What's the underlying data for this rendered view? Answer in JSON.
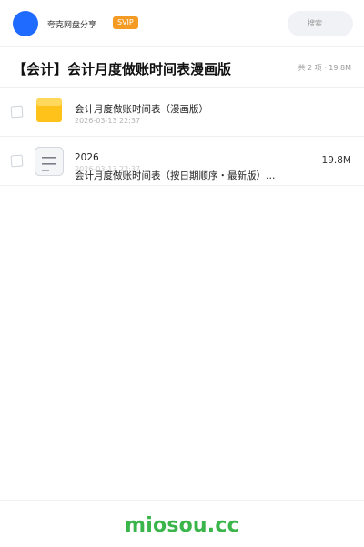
{
  "header": {
    "brand": "夸克网盘分享",
    "svip": "SVIP",
    "search_placeholder": "搜索"
  },
  "page": {
    "title": "【会计】会计月度做账时间表漫画版",
    "summary": "共 2 项 · 19.8M"
  },
  "files": [
    {
      "type": "folder",
      "name": "会计月度做账时间表（漫画版）",
      "date": "2026-03-13 22:37",
      "size": ""
    },
    {
      "type": "document",
      "year": "2026",
      "name": "会计月度做账时间表（按日期顺序・最新版）…",
      "date": "2026-03-13 22:37",
      "size": "19.8M"
    }
  ],
  "footer": {
    "watermark": "miosou.cc"
  },
  "colors": {
    "accent": "#1f6bff",
    "svip": "#f59a23",
    "folder": "#ffc21a",
    "watermark": "#39b54a"
  }
}
